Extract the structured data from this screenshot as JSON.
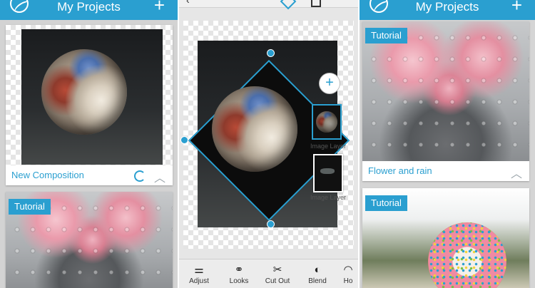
{
  "left_screen": {
    "header": {
      "title": "My Projects",
      "add_label": "+"
    },
    "card1": {
      "caption": "New Composition",
      "chevron": "︿"
    },
    "card2": {
      "tag": "Tutorial"
    }
  },
  "center_screen": {
    "add_layer_label": "+",
    "layers": [
      {
        "label": "Image Layer"
      },
      {
        "label": "Image Layer"
      }
    ],
    "toolbar": [
      {
        "icon": "adjust-icon",
        "glyph": "⚌",
        "label": "Adjust"
      },
      {
        "icon": "looks-icon",
        "glyph": "⚭",
        "label": "Looks"
      },
      {
        "icon": "cut-out-icon",
        "glyph": "✂",
        "label": "Cut Out"
      },
      {
        "icon": "blend-icon",
        "glyph": "◐",
        "label": "Blend"
      },
      {
        "icon": "more-icon",
        "glyph": "◠",
        "label": "Ho"
      }
    ]
  },
  "right_screen": {
    "header": {
      "title": "My Projects",
      "add_label": "+"
    },
    "card1": {
      "tag": "Tutorial",
      "caption": "Flower and rain",
      "chevron": "︿"
    },
    "card2": {
      "tag": "Tutorial"
    }
  },
  "colors": {
    "accent": "#2a9fd0",
    "header_bg": "#2a9fd0"
  }
}
